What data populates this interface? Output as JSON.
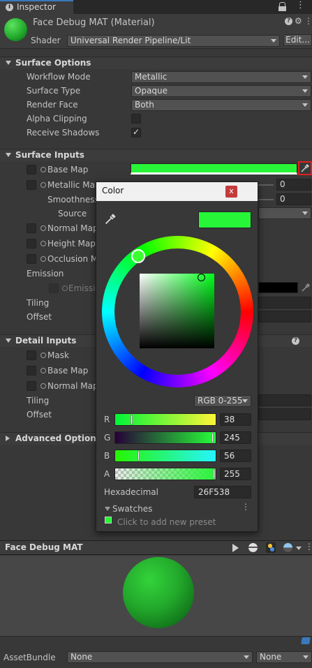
{
  "tab": {
    "title": "Inspector"
  },
  "material": {
    "name": "Face Debug MAT (Material)",
    "shader_label": "Shader",
    "shader_value": "Universal Render Pipeline/Lit",
    "edit_label": "Edit..."
  },
  "surface_options": {
    "title": "Surface Options",
    "rows": [
      {
        "label": "Workflow Mode",
        "value": "Metallic"
      },
      {
        "label": "Surface Type",
        "value": "Opaque"
      },
      {
        "label": "Render Face",
        "value": "Both"
      },
      {
        "label": "Alpha Clipping"
      },
      {
        "label": "Receive Shadows"
      }
    ]
  },
  "surface_inputs": {
    "title": "Surface Inputs",
    "base_map": "Base Map",
    "base_color": "#29f538",
    "metallic_map": "Metallic Map",
    "metallic_value": "0",
    "smoothness": "Smoothness",
    "smoothness_value": "0",
    "source": "Source",
    "normal_map": "Normal Map",
    "height_map": "Height Map",
    "occlusion_map": "Occlusion M",
    "emission": "Emission",
    "emission_map": "Emissio",
    "tiling": "Tiling",
    "offset": "Offset"
  },
  "detail_inputs": {
    "title": "Detail Inputs",
    "mask": "Mask",
    "base_map": "Base Map",
    "normal_map": "Normal Map",
    "tiling": "Tiling",
    "offset": "Offset"
  },
  "advanced": {
    "title": "Advanced Option"
  },
  "color_picker": {
    "title": "Color",
    "close": "x",
    "mode": "RGB 0-255",
    "channels": [
      {
        "label": "R",
        "value": "38"
      },
      {
        "label": "G",
        "value": "245"
      },
      {
        "label": "B",
        "value": "56"
      },
      {
        "label": "A",
        "value": "255"
      }
    ],
    "channel_fractions": [
      0.149,
      0.961,
      0.22,
      1.0
    ],
    "hex_label": "Hexadecimal",
    "hex_value": "26F538",
    "swatches_label": "Swatches",
    "swatches_hint": "Click to add new preset",
    "color": "#26f538"
  },
  "preview": {
    "title": "Face Debug MAT"
  },
  "footer": {
    "assetbundle_label": "AssetBundle",
    "bundle_value": "None",
    "variant_value": "None"
  }
}
